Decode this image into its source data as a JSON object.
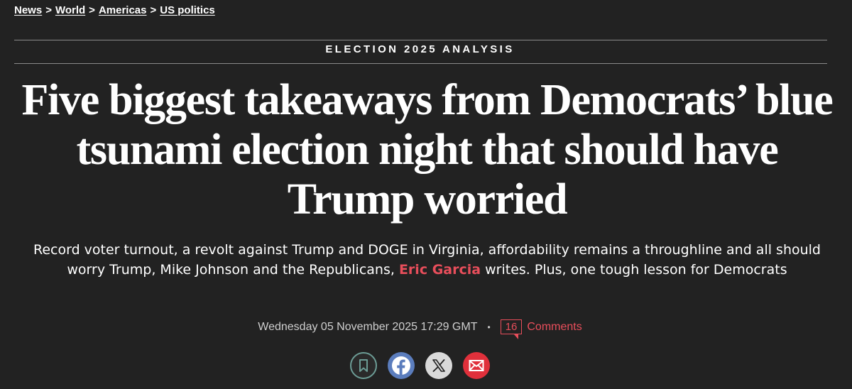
{
  "breadcrumb": {
    "items": [
      "News",
      "World",
      "Americas",
      "US politics"
    ],
    "separator": ">"
  },
  "section_label": "ELECTION 2025 ANALYSIS",
  "headline": "Five biggest takeaways from Democrats’ blue tsunami election night that should have Trump worried",
  "standfirst": {
    "before": "Record voter turnout, a revolt against Trump and DOGE in Virginia, affordability remains a throughline and all should worry Trump, Mike Johnson and the Republicans, ",
    "author": "Eric Garcia",
    "after": " writes. Plus, one tough lesson for Democrats"
  },
  "meta": {
    "date": "Wednesday 05 November 2025 17:29 GMT",
    "separator": "•",
    "comment_count": "16",
    "comments_label": "Comments"
  },
  "share": {
    "icons": [
      "bookmark-icon",
      "facebook-icon",
      "x-icon",
      "email-icon"
    ]
  },
  "colors": {
    "background": "#222222",
    "accent": "#e84e5b",
    "facebook": "#5b7dbd",
    "email": "#e0303b",
    "bookmark_ring": "#6c9c95"
  }
}
